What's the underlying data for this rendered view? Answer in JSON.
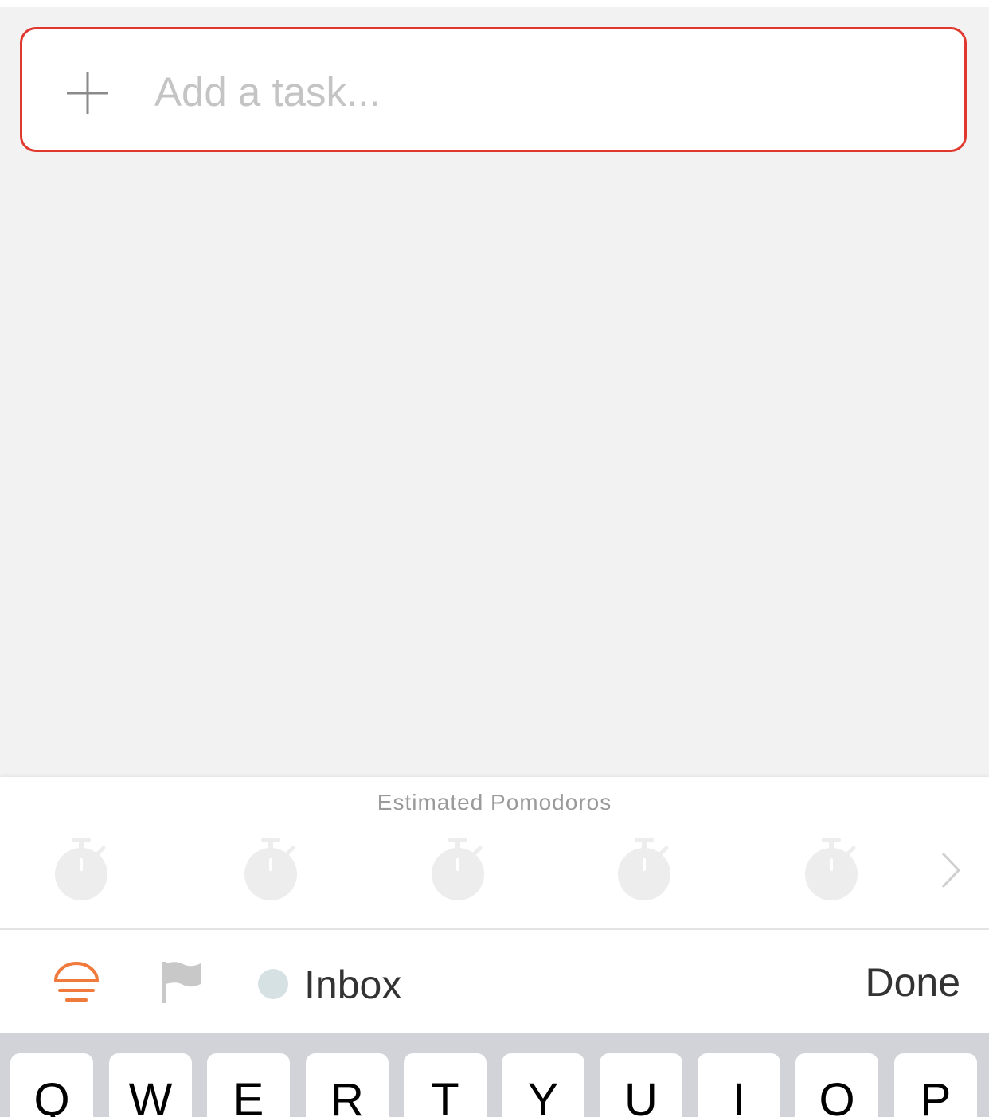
{
  "task_input": {
    "placeholder": "Add a task...",
    "value": ""
  },
  "pomodoro_picker": {
    "title": "Estimated Pomodoros",
    "icons": [
      "stopwatch-icon",
      "stopwatch-icon",
      "stopwatch-icon",
      "stopwatch-icon",
      "stopwatch-icon"
    ],
    "selected_count": 0
  },
  "toolbar": {
    "today_icon": "sunrise-icon",
    "priority_icon": "flag-icon",
    "project_label": "Inbox",
    "done_label": "Done"
  },
  "keyboard": {
    "row1": [
      "Q",
      "W",
      "E",
      "R",
      "T",
      "Y",
      "U",
      "I",
      "O",
      "P"
    ]
  },
  "colors": {
    "accent_red": "#e0382e",
    "today_orange": "#f07a3c",
    "inactive_gray": "#c8c8c8",
    "project_dot": "#d6e1e4"
  }
}
